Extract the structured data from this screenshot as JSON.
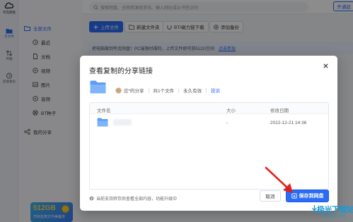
{
  "app": {
    "name": "夸克网盘"
  },
  "rail": {
    "items": [
      {
        "label": "云文件"
      },
      {
        "label": "传输"
      },
      {
        "label": "回收备份"
      }
    ]
  },
  "sidebar": {
    "all_files": "全部文件",
    "sub_items": [
      {
        "label": "最近"
      },
      {
        "label": "文档"
      },
      {
        "label": "视频"
      },
      {
        "label": "图片"
      },
      {
        "label": "音频"
      },
      {
        "label": "BT种子"
      }
    ],
    "my_share": "我的分享",
    "promo": {
      "big": "512GB",
      "small": "开启任意文件美备份"
    }
  },
  "topbar": {
    "search_placeholder": "搜索网盘、全网资源找资讯、输入网址或从书签访问",
    "open_button": "开通超"
  },
  "toolbar": {
    "upload": "上传文件",
    "new_folder": "新建文件夹",
    "bt_download": "BT/磁力链下载",
    "add_backup": "添加备份"
  },
  "notice": {
    "text": "把电脑搬到夸克网盘！PC端限时福利，上传文件即可获512G空间",
    "link": "点击参加"
  },
  "modal": {
    "title": "查看复制的分享链接",
    "share_owner": "应*的分享",
    "file_count": "共1个文件",
    "validity": "永久有效",
    "report": "投诉",
    "columns": {
      "name": "文件名",
      "size": "大小",
      "date": "修改日期"
    },
    "rows": [
      {
        "size": "-",
        "date": "2022-12-21 14:36"
      }
    ],
    "note": "当前支持转存后查看全部内容，功能升级中",
    "cancel": "取消",
    "save": "保存到网盘"
  },
  "watermark": {
    "line1": "极光下载站",
    "line2": "www.xz7.com"
  },
  "colors": {
    "accent": "#2b6cf6",
    "arrow": "#e02020",
    "folder": "#5b9cf6"
  }
}
